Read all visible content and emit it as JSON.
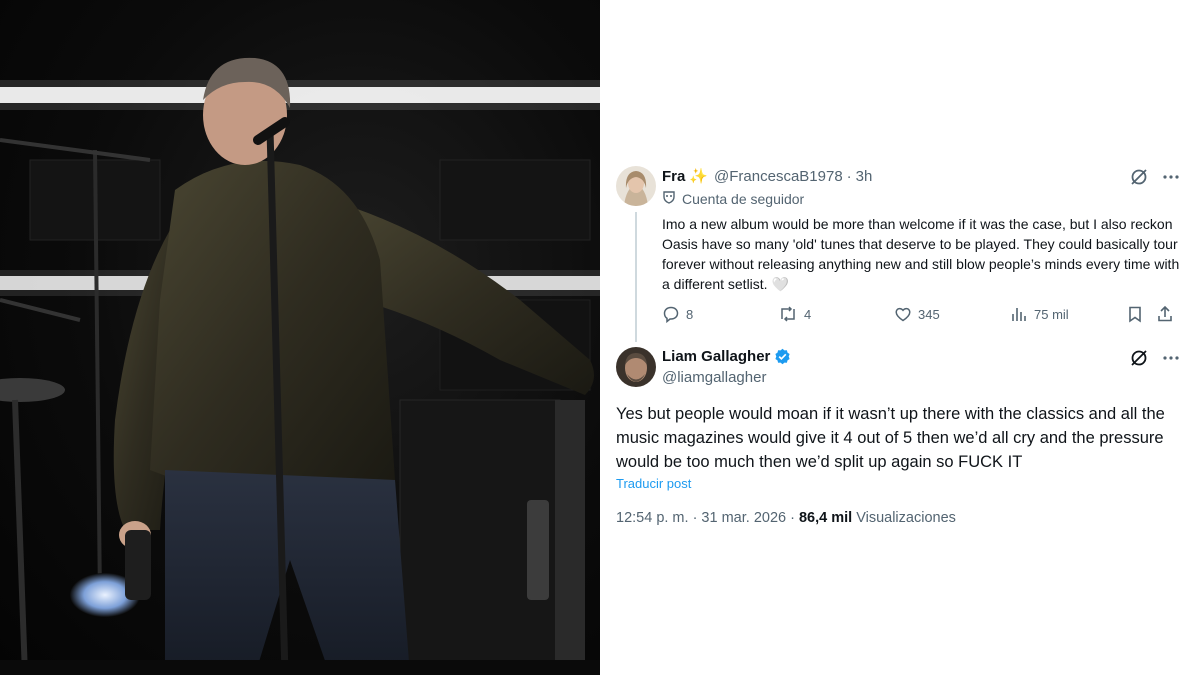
{
  "reply": {
    "display_name": "Fra",
    "emoji": "✨",
    "handle": "@FrancescaB1978",
    "separator": "·",
    "time": "3h",
    "follower_label": "Cuenta de seguidor",
    "text": "Imo a new album would be more than welcome if it was the case, but I also reckon Oasis have so many 'old' tunes that deserve to be played. They could basically tour forever without releasing anything new and still blow people’s minds every time with a different setlist. 🤍",
    "stats": {
      "replies": "8",
      "reposts": "4",
      "likes": "345",
      "views": "75 mil"
    }
  },
  "post": {
    "display_name": "Liam Gallagher",
    "handle": "@liamgallagher",
    "text": "Yes but people would moan if it wasn’t up there with the classics and all the music magazines would give it 4 out of 5 then we’d all cry and the pressure would be too much then we’d split up again so FUCK IT",
    "translate_label": "Traducir post",
    "timestamp": "12:54 p. m. · 31 mar. 2026 ·",
    "views_count": "86,4 mil",
    "views_label": "Visualizaciones"
  },
  "colors": {
    "verified": "#1d9bf0",
    "link": "#1d9bf0",
    "muted": "#536471",
    "text": "#0f1419"
  },
  "icons": [
    "grok-icon",
    "more-icon",
    "reply-icon",
    "repost-icon",
    "like-icon",
    "views-icon",
    "bookmark-icon",
    "share-icon",
    "verified-badge-icon",
    "follower-badge-icon"
  ]
}
